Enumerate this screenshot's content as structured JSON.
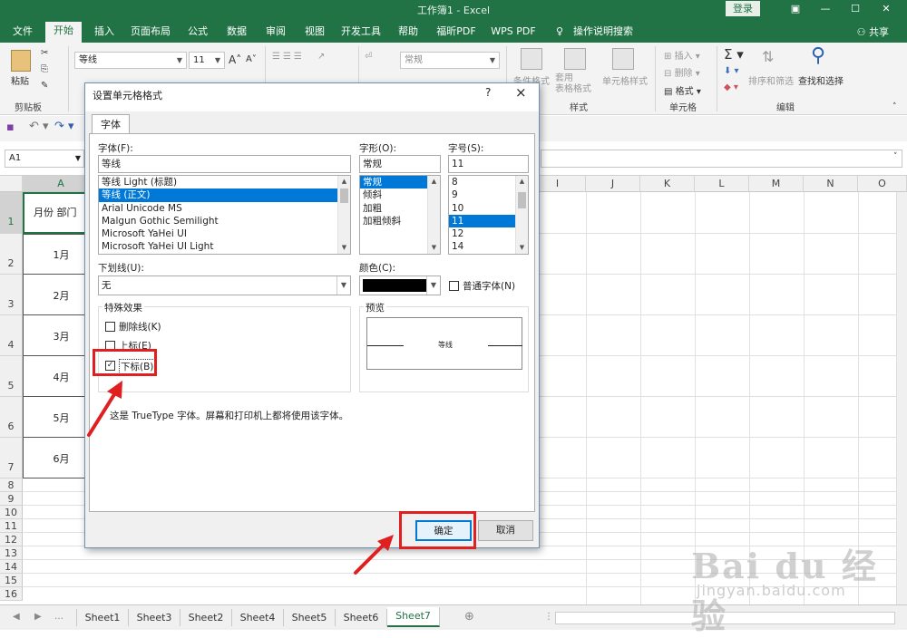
{
  "window": {
    "title": "工作簿1 - Excel",
    "login": "登录"
  },
  "ribbon_tabs": [
    "文件",
    "开始",
    "插入",
    "页面布局",
    "公式",
    "数据",
    "审阅",
    "视图",
    "开发工具",
    "帮助",
    "福昕PDF",
    "WPS PDF",
    "操作说明搜索"
  ],
  "share": "共享",
  "ribbon": {
    "paste": "粘贴",
    "clipboard": "剪贴板",
    "font_name": "等线",
    "font_size": "11",
    "grow_font": "A",
    "shrink_font": "A",
    "number_format": "常规",
    "conditional_format": "条件格式",
    "table_format": "套用\n表格格式",
    "cell_styles": "单元格样式",
    "styles_group": "样式",
    "insert": "插入",
    "delete": "删除",
    "format": "格式",
    "cells_group": "单元格",
    "sort_filter": "排序和筛选",
    "find_select": "查找和选择",
    "editing_group": "编辑"
  },
  "name_box": "A1",
  "columns": [
    "A",
    "I",
    "J",
    "K",
    "L",
    "M",
    "N",
    "O"
  ],
  "rows": [
    "1",
    "2",
    "3",
    "4",
    "5",
    "6",
    "7",
    "8",
    "9",
    "10",
    "11",
    "12",
    "13",
    "14",
    "15",
    "16"
  ],
  "cells": {
    "a1": "月份  部门",
    "a2": "1月",
    "a3": "2月",
    "a4": "3月",
    "a5": "4月",
    "a6": "5月",
    "a7": "6月"
  },
  "sheets": [
    "Sheet1",
    "Sheet3",
    "Sheet2",
    "Sheet4",
    "Sheet5",
    "Sheet6",
    "Sheet7"
  ],
  "active_sheet": "Sheet7",
  "dialog": {
    "title": "设置单元格格式",
    "help": "?",
    "close": "×",
    "tab": "字体",
    "font_label": "字体(F):",
    "font_value": "等线",
    "font_list": [
      "等线 Light (标题)",
      "等线 (正文)",
      "Arial Unicode MS",
      "Malgun Gothic Semilight",
      "Microsoft YaHei UI",
      "Microsoft YaHei UI Light"
    ],
    "style_label": "字形(O):",
    "style_value": "常规",
    "style_list": [
      "常规",
      "倾斜",
      "加粗",
      "加粗倾斜"
    ],
    "size_label": "字号(S):",
    "size_value": "11",
    "size_list": [
      "8",
      "9",
      "10",
      "11",
      "12",
      "14"
    ],
    "underline_label": "下划线(U):",
    "underline_value": "无",
    "color_label": "颜色(C):",
    "normal_font": "普通字体(N)",
    "effects_label": "特殊效果",
    "strikethrough": "删除线(K)",
    "superscript": "上标(E)",
    "subscript": "下标(B)",
    "preview_label": "预览",
    "preview_text": "等线",
    "note": "这是 TrueType 字体。屏幕和打印机上都将使用该字体。",
    "ok": "确定",
    "cancel": "取消"
  },
  "colors": {
    "excel_green": "#217346",
    "selection_blue": "#0078d7",
    "highlight_red": "#e02020"
  },
  "watermark": {
    "brand": "Bai du 经验",
    "url": "jingyan.baidu.com"
  }
}
